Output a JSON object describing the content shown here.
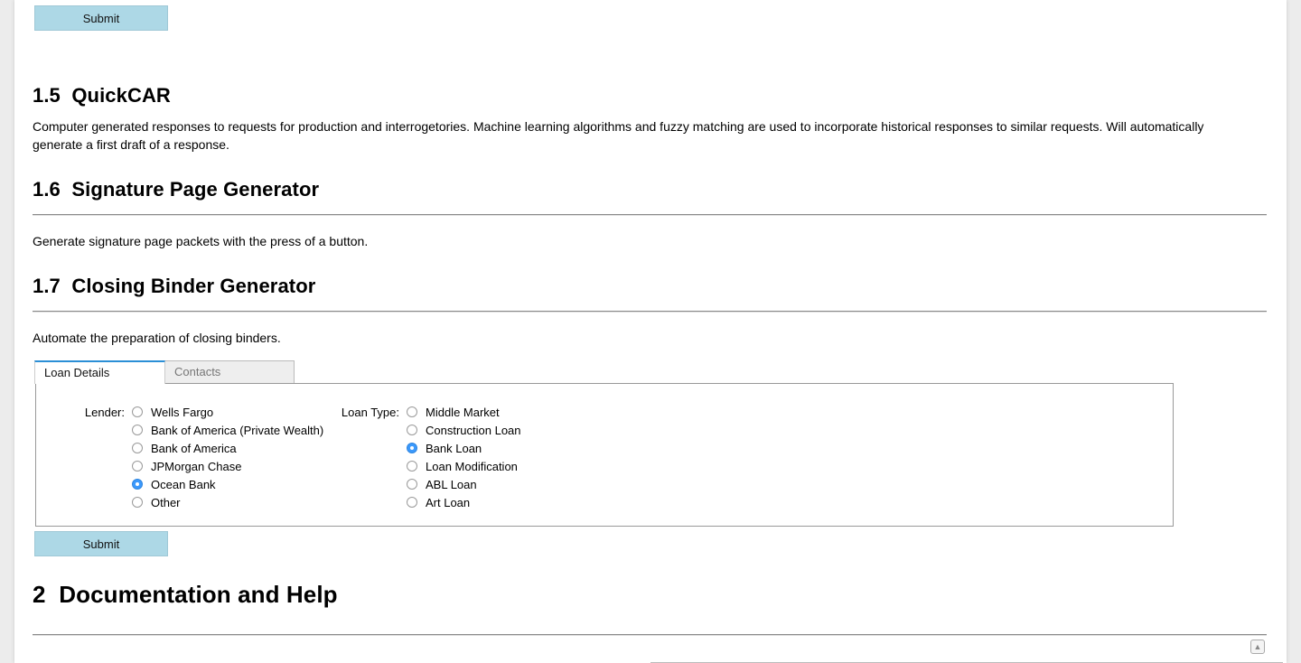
{
  "top_submit": {
    "label": "Submit"
  },
  "sections": {
    "quickcar": {
      "number": "1.5",
      "title": "QuickCAR",
      "text": "Computer generated responses to requests for production and interrogetories. Machine learning algorithms and fuzzy matching are used to incorporate historical responses to similar requests. Will automatically generate a first draft of a response."
    },
    "signature": {
      "number": "1.6",
      "title": "Signature Page Generator",
      "text": "Generate signature page packets with the press of a button."
    },
    "binder": {
      "number": "1.7",
      "title": "Closing Binder Generator",
      "text": "Automate the preparation of closing binders."
    },
    "docs": {
      "number": "2",
      "title": "Documentation and Help"
    }
  },
  "tabs": [
    {
      "label": "Loan Details",
      "active": true
    },
    {
      "label": "Contacts",
      "active": false
    }
  ],
  "form": {
    "lender_label": "Lender:",
    "lender_options": [
      "Wells Fargo",
      "Bank of America (Private Wealth)",
      "Bank of America",
      "JPMorgan Chase",
      "Ocean Bank",
      "Other"
    ],
    "lender_selected": "Ocean Bank",
    "loan_type_label": "Loan Type:",
    "loan_type_options": [
      "Middle Market",
      "Construction Loan",
      "Bank Loan",
      "Loan Modification",
      "ABL Loan",
      "Art Loan"
    ],
    "loan_type_selected": "Bank Loan"
  },
  "bottom_submit": {
    "label": "Submit"
  },
  "icons": {
    "scroll_top": "scroll-to-top-icon"
  },
  "colors": {
    "button_bg": "#add8e6",
    "radio_checked": "#3b99fc",
    "tab_active_border": "#2b8fd6"
  }
}
